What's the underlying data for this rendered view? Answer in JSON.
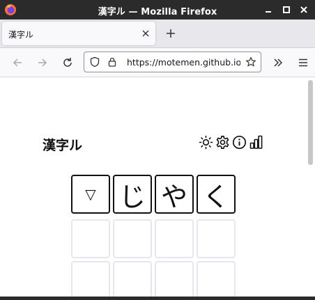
{
  "window": {
    "title": "漢字ル — Mozilla Firefox"
  },
  "tab": {
    "label": "漢字ル"
  },
  "urlbar": {
    "url": "https://motemen.github.io/"
  },
  "app": {
    "title": "漢字ル",
    "icons": [
      "sun-icon",
      "gear-icon",
      "info-icon",
      "stats-icon"
    ]
  },
  "board": {
    "current_row": [
      "▽",
      "じ",
      "や",
      "く"
    ],
    "empty_rows_visible": 2,
    "columns": 4
  },
  "colors": {
    "titlebar": "#2b2b2b",
    "tile_border_filled": "#111111",
    "tile_border_empty": "#e6e6ee"
  }
}
